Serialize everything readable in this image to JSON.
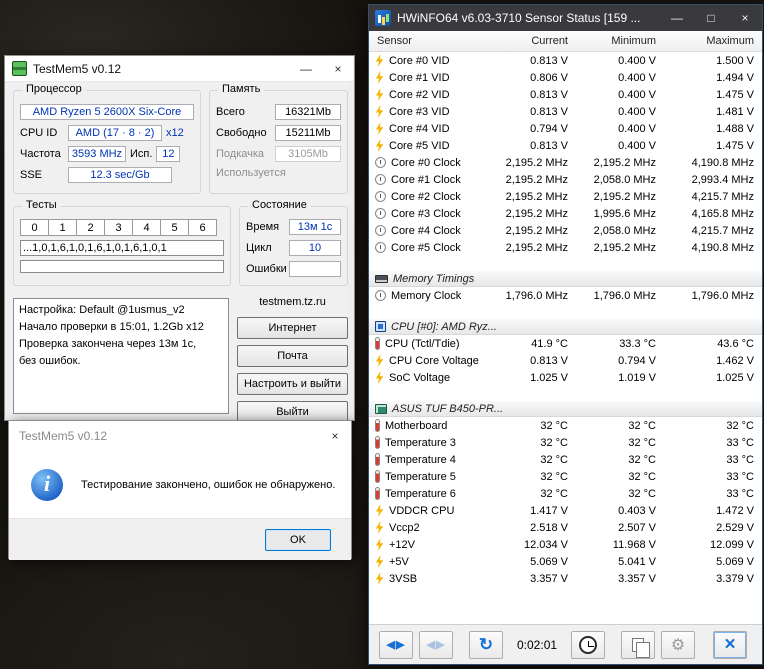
{
  "window_controls": {
    "minimize": "—",
    "maximize": "□",
    "close": "×"
  },
  "testmem": {
    "title": "TestMem5 v0.12",
    "cpu_group": {
      "label": "Процессор",
      "cpu_name": "AMD Ryzen 5 2600X Six-Core",
      "cpu_id_label": "CPU ID",
      "cpu_id_value": "AMD (17 · 8 · 2)",
      "cpu_id_mult": "x12",
      "freq_label": "Частота",
      "freq_value": "3593 MHz",
      "isp_label": "Исп.",
      "isp_value": "12",
      "sse_label": "SSE",
      "sse_value": "12.3 sec/Gb"
    },
    "mem_group": {
      "label": "Память",
      "rows": [
        {
          "label": "Всего",
          "value": "16321Mb"
        },
        {
          "label": "Свободно",
          "value": "15211Mb"
        },
        {
          "label": "Подкачка",
          "value": "3105Mb"
        },
        {
          "label": "Используется",
          "value": ""
        }
      ]
    },
    "tests_group": {
      "label": "Тесты",
      "cells": [
        "0",
        "1",
        "2",
        "3",
        "4",
        "5",
        "6"
      ],
      "sequence": "...1,0,1,6,1,0,1,6,1,0,1,6,1,0,1"
    },
    "state_group": {
      "label": "Состояние",
      "rows": [
        {
          "label": "Время",
          "value": "13м 1с"
        },
        {
          "label": "Цикл",
          "value": "10"
        },
        {
          "label": "Ошибки",
          "value": ""
        }
      ]
    },
    "log_text": "Настройка: Default @1usmus_v2\nНачало проверки в 15:01, 1.2Gb x12\nПроверка закончена через 13м 1с,\nбез ошибок.",
    "site": "testmem.tz.ru",
    "buttons": [
      "Интернет",
      "Почта",
      "Настроить и выйти",
      "Выйти"
    ]
  },
  "dialog": {
    "title": "TestMem5 v0.12",
    "message": "Тестирование закончено, ошибок не обнаружено.",
    "ok": "OK"
  },
  "hwinfo": {
    "title": "HWiNFO64 v6.03-3710 Sensor Status [159 ...",
    "columns": [
      "Sensor",
      "Current",
      "Minimum",
      "Maximum"
    ],
    "rows": [
      {
        "type": "sensor",
        "icon": "voltage-icon",
        "label": "Core #0 VID",
        "current": "0.813 V",
        "min": "0.400 V",
        "max": "1.500 V"
      },
      {
        "type": "sensor",
        "icon": "voltage-icon",
        "label": "Core #1 VID",
        "current": "0.806 V",
        "min": "0.400 V",
        "max": "1.494 V"
      },
      {
        "type": "sensor",
        "icon": "voltage-icon",
        "label": "Core #2 VID",
        "current": "0.813 V",
        "min": "0.400 V",
        "max": "1.475 V"
      },
      {
        "type": "sensor",
        "icon": "voltage-icon",
        "label": "Core #3 VID",
        "current": "0.813 V",
        "min": "0.400 V",
        "max": "1.481 V"
      },
      {
        "type": "sensor",
        "icon": "voltage-icon",
        "label": "Core #4 VID",
        "current": "0.794 V",
        "min": "0.400 V",
        "max": "1.488 V"
      },
      {
        "type": "sensor",
        "icon": "voltage-icon",
        "label": "Core #5 VID",
        "current": "0.813 V",
        "min": "0.400 V",
        "max": "1.475 V"
      },
      {
        "type": "sensor",
        "icon": "clock-icon",
        "label": "Core #0 Clock",
        "current": "2,195.2 MHz",
        "min": "2,195.2 MHz",
        "max": "4,190.8 MHz"
      },
      {
        "type": "sensor",
        "icon": "clock-icon",
        "label": "Core #1 Clock",
        "current": "2,195.2 MHz",
        "min": "2,058.0 MHz",
        "max": "2,993.4 MHz"
      },
      {
        "type": "sensor",
        "icon": "clock-icon",
        "label": "Core #2 Clock",
        "current": "2,195.2 MHz",
        "min": "2,195.2 MHz",
        "max": "4,215.7 MHz"
      },
      {
        "type": "sensor",
        "icon": "clock-icon",
        "label": "Core #3 Clock",
        "current": "2,195.2 MHz",
        "min": "1,995.6 MHz",
        "max": "4,165.8 MHz"
      },
      {
        "type": "sensor",
        "icon": "clock-icon",
        "label": "Core #4 Clock",
        "current": "2,195.2 MHz",
        "min": "2,058.0 MHz",
        "max": "4,215.7 MHz"
      },
      {
        "type": "sensor",
        "icon": "clock-icon",
        "label": "Core #5 Clock",
        "current": "2,195.2 MHz",
        "min": "2,195.2 MHz",
        "max": "4,190.8 MHz"
      },
      {
        "type": "spacer"
      },
      {
        "type": "section",
        "icon": "memory-icon",
        "label": "Memory Timings"
      },
      {
        "type": "sensor",
        "icon": "clock-icon",
        "label": "Memory Clock",
        "current": "1,796.0 MHz",
        "min": "1,796.0 MHz",
        "max": "1,796.0 MHz"
      },
      {
        "type": "spacer"
      },
      {
        "type": "section",
        "icon": "cpu-icon",
        "label": "CPU [#0]: AMD Ryz..."
      },
      {
        "type": "sensor",
        "icon": "thermometer-icon",
        "label": "CPU (Tctl/Tdie)",
        "current": "41.9 °C",
        "min": "33.3 °C",
        "max": "43.6 °C"
      },
      {
        "type": "sensor",
        "icon": "voltage-icon",
        "label": "CPU Core Voltage",
        "current": "0.813 V",
        "min": "0.794 V",
        "max": "1.462 V"
      },
      {
        "type": "sensor",
        "icon": "voltage-icon",
        "label": "SoC Voltage",
        "current": "1.025 V",
        "min": "1.019 V",
        "max": "1.025 V"
      },
      {
        "type": "spacer"
      },
      {
        "type": "section",
        "icon": "motherboard-icon",
        "label": "ASUS TUF B450-PR..."
      },
      {
        "type": "sensor",
        "icon": "thermometer-icon",
        "label": "Motherboard",
        "current": "32 °C",
        "min": "32 °C",
        "max": "32 °C"
      },
      {
        "type": "sensor",
        "icon": "thermometer-icon",
        "label": "Temperature 3",
        "current": "32 °C",
        "min": "32 °C",
        "max": "33 °C"
      },
      {
        "type": "sensor",
        "icon": "thermometer-icon",
        "label": "Temperature 4",
        "current": "32 °C",
        "min": "32 °C",
        "max": "33 °C"
      },
      {
        "type": "sensor",
        "icon": "thermometer-icon",
        "label": "Temperature 5",
        "current": "32 °C",
        "min": "32 °C",
        "max": "33 °C"
      },
      {
        "type": "sensor",
        "icon": "thermometer-icon",
        "label": "Temperature 6",
        "current": "32 °C",
        "min": "32 °C",
        "max": "33 °C"
      },
      {
        "type": "sensor",
        "icon": "voltage-icon",
        "label": "VDDCR CPU",
        "current": "1.417 V",
        "min": "0.403 V",
        "max": "1.472 V"
      },
      {
        "type": "sensor",
        "icon": "voltage-icon",
        "label": "Vccp2",
        "current": "2.518 V",
        "min": "2.507 V",
        "max": "2.529 V"
      },
      {
        "type": "sensor",
        "icon": "voltage-icon",
        "label": "+12V",
        "current": "12.034 V",
        "min": "11.968 V",
        "max": "12.099 V"
      },
      {
        "type": "sensor",
        "icon": "voltage-icon",
        "label": "+5V",
        "current": "5.069 V",
        "min": "5.041 V",
        "max": "5.069 V"
      },
      {
        "type": "sensor",
        "icon": "voltage-icon",
        "label": "3VSB",
        "current": "3.357 V",
        "min": "3.357 V",
        "max": "3.379 V"
      }
    ],
    "toolbar": {
      "time": "0:02:01",
      "icons": [
        "nav-arrows-icon",
        "nav-arrows-disabled-icon",
        "refresh-icon",
        "wall-clock-icon",
        "report-icon",
        "settings-gear-icon",
        "close-icon"
      ]
    }
  }
}
